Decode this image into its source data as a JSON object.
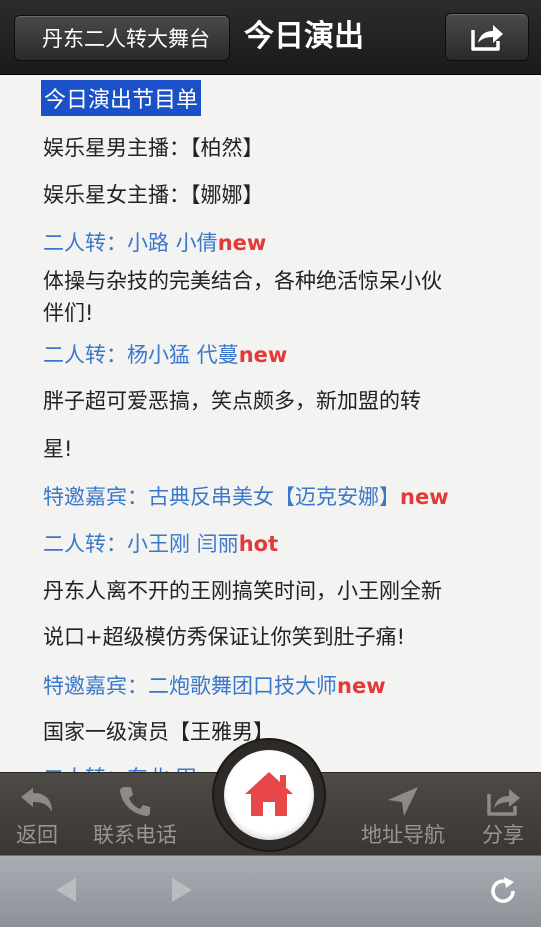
{
  "navbar": {
    "back_label": "丹东二人转大舞台",
    "title": "今日演出",
    "share_icon": "share-box-icon"
  },
  "content": {
    "heading": "今日演出节目单",
    "line1": "娱乐星男主播：【柏然】",
    "line2": "娱乐星女主播：【娜娜】",
    "act1_text": "二人转：小路  小倩",
    "act1_tag": "new",
    "desc1_a": "体操与杂技的完美结合，各种绝活惊呆小伙",
    "desc1_b": "伴们!",
    "act2_text": "二人转：杨小猛 代蔓",
    "act2_tag": "new",
    "desc2_a": "胖子超可爱恶搞，笑点颇多，新加盟的转",
    "desc2_b": "星!",
    "guest1_text": "特邀嘉宾：古典反串美女【迈克安娜】",
    "guest1_tag": "new",
    "act3_text": "二人转：小王刚 闫丽",
    "act3_tag": "hot",
    "desc3_a": "丹东人离不开的王刚搞笑时间，小王刚全新",
    "desc3_b": "说口+超级模仿秀保证让你笑到肚子痛!",
    "guest2_text": "特邀嘉宾：二炮歌舞团口技大师",
    "guest2_tag": "new",
    "line_last": "国家一级演员【王雅男】",
    "line_partial": "二人转：东北 田"
  },
  "toolbar": {
    "back_label": "返回",
    "phone_label": "联系电话",
    "nav_label": "地址导航",
    "share_label": "分享"
  },
  "colors": {
    "blue_text": "#3b78cc",
    "tag_red": "#e23a3a",
    "heading_bg": "#1c50c8",
    "home_red": "#e8474a"
  }
}
